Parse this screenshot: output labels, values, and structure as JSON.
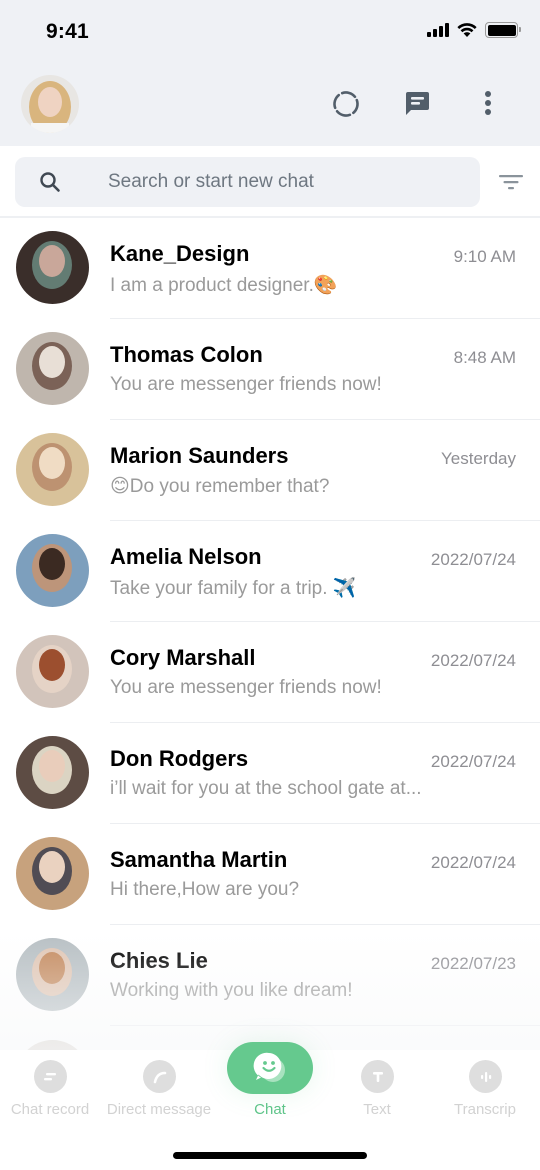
{
  "status_bar": {
    "time": "9:41",
    "signal_icon": "cellular-signal-icon",
    "wifi_icon": "wifi-icon",
    "battery_icon": "battery-full-icon"
  },
  "header": {
    "profile_avatar": "user-avatar",
    "actions": [
      {
        "name": "status",
        "icon": "status-ring-icon"
      },
      {
        "name": "new-chat",
        "icon": "chat-bubble-icon"
      },
      {
        "name": "more",
        "icon": "more-vertical-icon"
      }
    ]
  },
  "search": {
    "placeholder": "Search or start new chat",
    "value": "",
    "icon": "search-icon",
    "filter_icon": "filter-icon"
  },
  "chats": [
    {
      "name": "Kane_Design",
      "time": "9:10 AM",
      "preview": "I am a product designer.🎨",
      "avatar_colors": [
        "#3a2e2a",
        "#c9a79a",
        "#6b8a80"
      ]
    },
    {
      "name": "Thomas Colon",
      "time": "8:48 AM",
      "preview": "You are messenger friends now!",
      "avatar_colors": [
        "#bfb6ad",
        "#e8dfd6",
        "#6e5448"
      ]
    },
    {
      "name": "Marion Saunders",
      "time": "Yesterday",
      "preview": "😊Do you remember that?",
      "avatar_colors": [
        "#d8c29a",
        "#f0dcc4",
        "#b98a6a"
      ]
    },
    {
      "name": "Amelia Nelson",
      "time": "2022/07/24",
      "preview": "Take your family for a trip. ✈️",
      "avatar_colors": [
        "#7d9fbd",
        "#3b2a22",
        "#c8936e"
      ]
    },
    {
      "name": "Cory Marshall",
      "time": "2022/07/24",
      "preview": "You are messenger friends now!",
      "avatar_colors": [
        "#d2c4bb",
        "#9c4f2f",
        "#e9d6c8"
      ]
    },
    {
      "name": "Don Rodgers",
      "time": "2022/07/24",
      "preview": "i’ll wait for you at the school gate at...",
      "avatar_colors": [
        "#5d4c44",
        "#e9cdbb",
        "#f1ecd9"
      ]
    },
    {
      "name": "Samantha Martin",
      "time": "2022/07/24",
      "preview": "Hi there,How are you?",
      "avatar_colors": [
        "#c7a27d",
        "#ead2c0",
        "#3b3d4c"
      ]
    },
    {
      "name": "Chies Lie",
      "time": "2022/07/23",
      "preview": "Working with you like dream!",
      "avatar_colors": [
        "#b7bfc3",
        "#c48a5e",
        "#e7c7b2"
      ]
    }
  ],
  "tabs": [
    {
      "label": "Chat record",
      "icon": "chat-record-icon",
      "active": false
    },
    {
      "label": "Direct message",
      "icon": "direct-message-icon",
      "active": false
    },
    {
      "label": "Chat",
      "icon": "smiley-chat-icon",
      "active": true
    },
    {
      "label": "Text",
      "icon": "text-icon",
      "active": false
    },
    {
      "label": "Transcrip",
      "icon": "transcript-icon",
      "active": false
    }
  ],
  "colors": {
    "accent": "#65c98e",
    "accent_text": "#5ec489",
    "header_bg": "#eff1f5",
    "icon_gray": "#525e6a"
  }
}
